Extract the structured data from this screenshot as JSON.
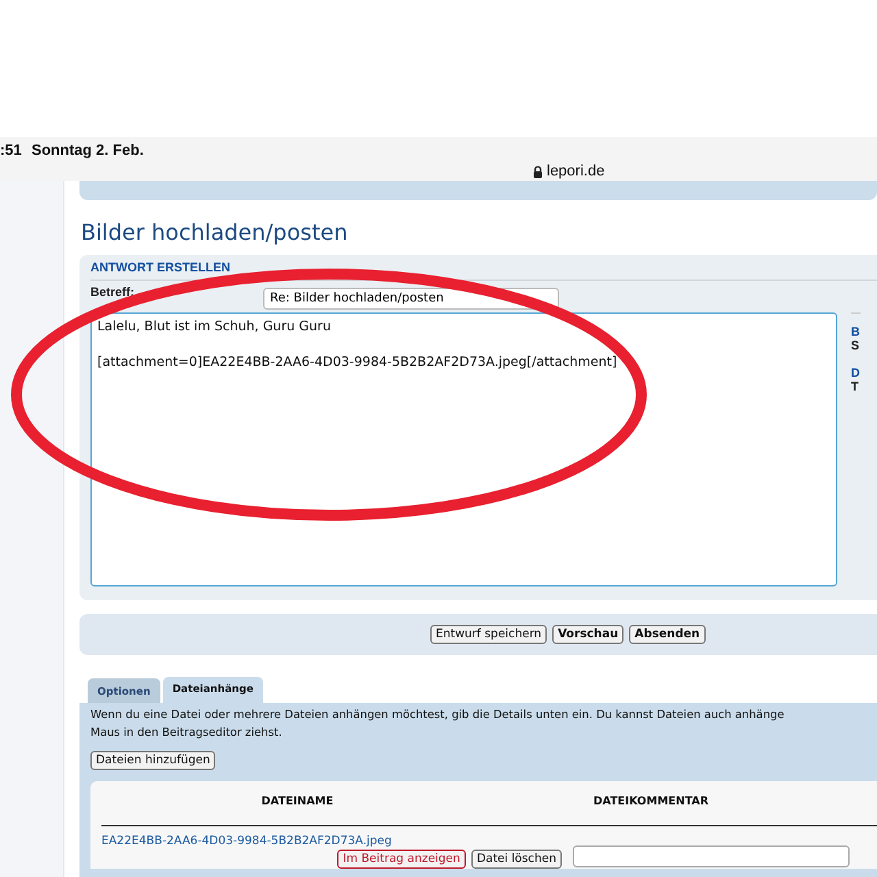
{
  "status_bar": {
    "time": ":51",
    "date": "Sonntag 2. Feb.",
    "url": "lepori.de"
  },
  "page_title": "Bilder hochladen/posten",
  "reply_panel": {
    "heading": "ANTWORT ERSTELLEN",
    "subject_label": "Betreff:",
    "subject_value": "Re: Bilder hochladen/posten",
    "message_paragraphs": [
      "Lalelu, Blut ist im Schuh, Guru Guru",
      "[attachment=0]EA22E4BB-2AA6-4D03-9984-5B2B2AF2D73A.jpeg[/attachment]"
    ]
  },
  "side_column": [
    {
      "label": "B",
      "value": "S"
    },
    {
      "label": "D",
      "value": "T"
    }
  ],
  "buttons": [
    {
      "label": "Entwurf speichern",
      "bold": false
    },
    {
      "label": "Vorschau",
      "bold": true
    },
    {
      "label": "Absenden",
      "bold": true
    }
  ],
  "tabs": [
    {
      "label": "Optionen",
      "selected": false
    },
    {
      "label": "Dateianhänge",
      "selected": true
    }
  ],
  "attachments": {
    "info_lines": [
      "Wenn du eine Datei oder mehrere Dateien anhängen möchtest, gib die Details unten ein. Du kannst Dateien auch anhänge",
      "Maus in den Beitragseditor ziehst."
    ],
    "add_button": "Dateien hinzufügen",
    "columns": [
      "DATEINAME",
      "DATEIKOMMENTAR"
    ],
    "rows": [
      {
        "filename": "EA22E4BB-2AA6-4D03-9984-5B2B2AF2D73A.jpeg",
        "insert_button": "Im Beitrag anzeigen",
        "delete_button": "Datei löschen"
      }
    ]
  }
}
